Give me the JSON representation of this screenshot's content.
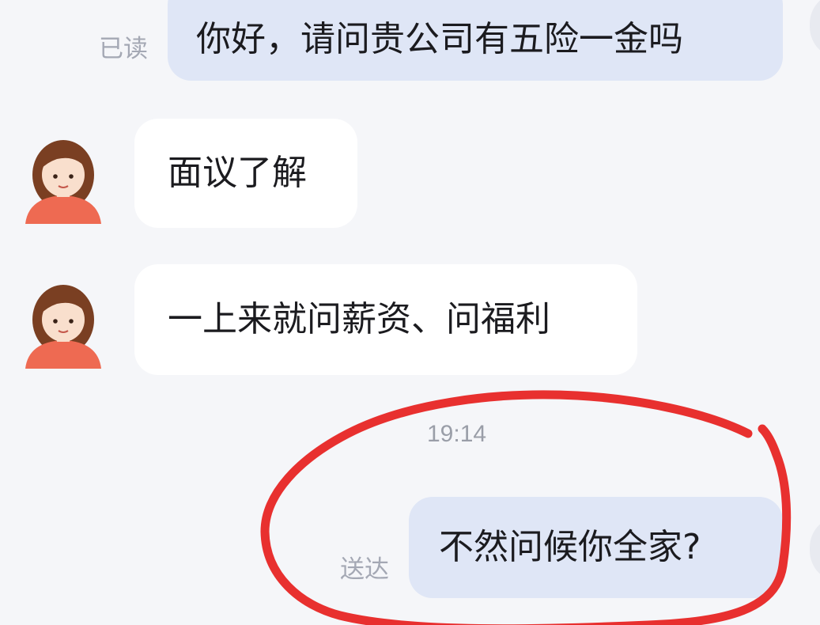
{
  "messages": [
    {
      "direction": "outgoing",
      "text": "你好，请问贵公司有五险一金吗",
      "status": "已读"
    },
    {
      "direction": "incoming",
      "text": "面议了解"
    },
    {
      "direction": "incoming",
      "text": "一上来就问薪资、问福利"
    },
    {
      "direction": "outgoing",
      "text": "不然问候你全家?",
      "status": "送达"
    }
  ],
  "timestamp": "19:14",
  "colors": {
    "background": "#f5f6f9",
    "outgoing_bubble": "#dfe6f6",
    "incoming_bubble": "#ffffff",
    "annotation": "#e8302f"
  },
  "icons": {
    "contact_avatar": "cartoon-girl-avatar",
    "annotation": "red-hand-drawn-circle"
  }
}
